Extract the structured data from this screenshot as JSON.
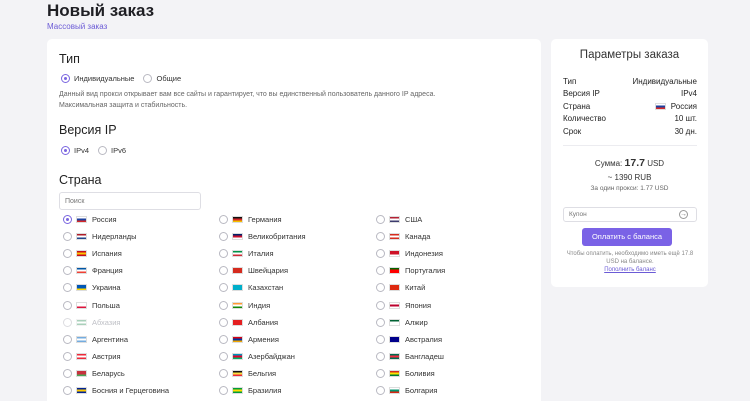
{
  "page": {
    "title": "Новый заказ",
    "breadcrumb": "Массовый заказ"
  },
  "type_section": {
    "title": "Тип",
    "options": [
      "Индивидуальные",
      "Общие"
    ],
    "selected": "Индивидуальные",
    "description": "Данный вид прокси открывает вам все сайты и гарантирует, что вы единственный пользователь данного IP адреса. Максимальная защита и стабильность."
  },
  "ip_section": {
    "title": "Версия IP",
    "options": [
      "IPv4",
      "IPv6"
    ],
    "selected": "IPv4"
  },
  "country_section": {
    "title": "Страна",
    "search_placeholder": "Поиск",
    "countries": [
      {
        "name": "Россия",
        "flag": [
          "#ffffff",
          "#1c3f9e",
          "#d62828"
        ],
        "selected": true
      },
      {
        "name": "Германия",
        "flag": [
          "#111111",
          "#d62828",
          "#f2c200"
        ]
      },
      {
        "name": "США",
        "flag": [
          "#b22234",
          "#ffffff",
          "#3c3b6e"
        ]
      },
      {
        "name": "Нидерланды",
        "flag": [
          "#ae1c28",
          "#ffffff",
          "#21468b"
        ]
      },
      {
        "name": "Великобритания",
        "flag": [
          "#012169",
          "#c8102e",
          "#ffffff"
        ]
      },
      {
        "name": "Канада",
        "flag": [
          "#d52b1e",
          "#ffffff",
          "#d52b1e"
        ]
      },
      {
        "name": "Испания",
        "flag": [
          "#c60b1e",
          "#ffc400",
          "#c60b1e"
        ]
      },
      {
        "name": "Италия",
        "flag": [
          "#009246",
          "#ffffff",
          "#ce2b37"
        ]
      },
      {
        "name": "Индонезия",
        "flag": [
          "#ce1126",
          "#ce1126",
          "#ffffff"
        ]
      },
      {
        "name": "Франция",
        "flag": [
          "#0055a4",
          "#ffffff",
          "#ef4135"
        ]
      },
      {
        "name": "Швейцария",
        "flag": [
          "#d52b1e",
          "#d52b1e",
          "#d52b1e"
        ]
      },
      {
        "name": "Португалия",
        "flag": [
          "#006600",
          "#ff0000",
          "#ff0000"
        ]
      },
      {
        "name": "Украина",
        "flag": [
          "#0057b7",
          "#0057b7",
          "#ffd700"
        ]
      },
      {
        "name": "Казахстан",
        "flag": [
          "#00afca",
          "#00afca",
          "#00afca"
        ]
      },
      {
        "name": "Китай",
        "flag": [
          "#de2910",
          "#de2910",
          "#de2910"
        ]
      },
      {
        "name": "Польша",
        "flag": [
          "#ffffff",
          "#ffffff",
          "#dc143c"
        ]
      },
      {
        "name": "Индия",
        "flag": [
          "#ff9933",
          "#ffffff",
          "#138808"
        ]
      },
      {
        "name": "Япония",
        "flag": [
          "#ffffff",
          "#bc002d",
          "#ffffff"
        ]
      },
      {
        "name": "Абхазия",
        "flag": [
          "#2e8b57",
          "#ffffff",
          "#2e8b57"
        ],
        "disabled": true
      },
      {
        "name": "Албания",
        "flag": [
          "#e41e20",
          "#e41e20",
          "#e41e20"
        ]
      },
      {
        "name": "Алжир",
        "flag": [
          "#006233",
          "#ffffff",
          "#ffffff"
        ]
      },
      {
        "name": "Аргентина",
        "flag": [
          "#74acdf",
          "#ffffff",
          "#74acdf"
        ]
      },
      {
        "name": "Армения",
        "flag": [
          "#d90012",
          "#0033a0",
          "#f2a800"
        ]
      },
      {
        "name": "Австралия",
        "flag": [
          "#00008b",
          "#00008b",
          "#00008b"
        ]
      },
      {
        "name": "Австрия",
        "flag": [
          "#ed2939",
          "#ffffff",
          "#ed2939"
        ]
      },
      {
        "name": "Азербайджан",
        "flag": [
          "#0092bc",
          "#e4002b",
          "#00af66"
        ]
      },
      {
        "name": "Бангладеш",
        "flag": [
          "#006a4e",
          "#f42a41",
          "#006a4e"
        ]
      },
      {
        "name": "Беларусь",
        "flag": [
          "#c8313e",
          "#c8313e",
          "#4aa657"
        ]
      },
      {
        "name": "Бельгия",
        "flag": [
          "#111111",
          "#fae042",
          "#ed2939"
        ]
      },
      {
        "name": "Боливия",
        "flag": [
          "#d52b1e",
          "#f9e300",
          "#007934"
        ]
      },
      {
        "name": "Босния и Герцеговина",
        "flag": [
          "#002395",
          "#fecb00",
          "#002395"
        ]
      },
      {
        "name": "Бразилия",
        "flag": [
          "#009c3b",
          "#ffdf00",
          "#009c3b"
        ]
      },
      {
        "name": "Болгария",
        "flag": [
          "#ffffff",
          "#00966e",
          "#d62612"
        ]
      }
    ]
  },
  "summary": {
    "title": "Параметры заказа",
    "rows": [
      {
        "label": "Тип",
        "value": "Индивидуальные"
      },
      {
        "label": "Версия IP",
        "value": "IPv4"
      },
      {
        "label": "Страна",
        "value": "Россия",
        "flag": true
      },
      {
        "label": "Количество",
        "value": "10 шт."
      },
      {
        "label": "Срок",
        "value": "30 дн."
      }
    ],
    "sum_label": "Сумма:",
    "sum_value": "17.7",
    "sum_currency": "USD",
    "rub": "~ 1390 RUB",
    "per_proxy": "За один прокси: 1.77 USD",
    "coupon_placeholder": "Купон",
    "coupon_button": "→",
    "pay_button": "Оплатить с баланса",
    "note": "Чтобы оплатить, необходимо иметь ещё 17.8 USD на балансе.",
    "note_link": "Пополнить баланс"
  }
}
